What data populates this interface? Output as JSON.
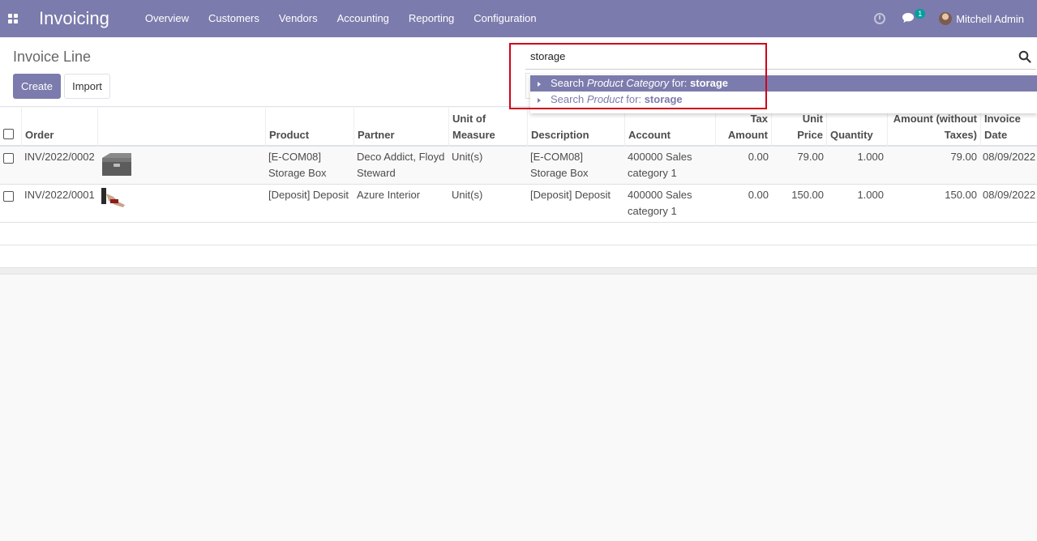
{
  "app": {
    "title": "Invoicing"
  },
  "nav": {
    "menu": [
      "Overview",
      "Customers",
      "Vendors",
      "Accounting",
      "Reporting",
      "Configuration"
    ],
    "chat_badge": "1",
    "user": "Mitchell Admin"
  },
  "control": {
    "title": "Invoice Line",
    "create_label": "Create",
    "import_label": "Import"
  },
  "search": {
    "value": "storage",
    "suggestions": [
      {
        "prefix": "Search",
        "field": "Product Category",
        "mid": "for:",
        "term": "storage"
      },
      {
        "prefix": "Search",
        "field": "Product",
        "mid": "for:",
        "term": "storage"
      }
    ]
  },
  "table": {
    "headers": {
      "order": "Order",
      "image": "",
      "product": "Product",
      "partner": "Partner",
      "uom_1": "Unit of",
      "uom_2": "Measure",
      "description": "Description",
      "account": "Account",
      "tax_1": "Tax",
      "tax_2": "Amount",
      "unit_1": "Unit",
      "unit_2": "Price",
      "quantity": "Quantity",
      "amount_1": "Amount (without",
      "amount_2": "Taxes)",
      "date_1": "Invoice",
      "date_2": "Date"
    },
    "rows": [
      {
        "order": "INV/2022/0002",
        "product_1": "[E-COM08]",
        "product_2": "Storage Box",
        "partner_1": "Deco Addict, Floyd",
        "partner_2": "Steward",
        "uom": "Unit(s)",
        "description_1": "[E-COM08]",
        "description_2": "Storage Box",
        "account_1": "400000 Sales",
        "account_2": "category 1",
        "tax": "0.00",
        "unit_price": "79.00",
        "quantity": "1.000",
        "amount": "79.00",
        "date": "08/09/2022"
      },
      {
        "order": "INV/2022/0001",
        "product_1": "[Deposit] Deposit",
        "partner_1": "Azure Interior",
        "uom": "Unit(s)",
        "description_1": "[Deposit] Deposit",
        "account_1": "400000 Sales",
        "account_2": "category 1",
        "tax": "0.00",
        "unit_price": "150.00",
        "quantity": "1.000",
        "amount": "150.00",
        "date": "08/09/2022"
      }
    ]
  },
  "colors": {
    "brand": "#7c7bad",
    "highlight": "#d0021b",
    "badge": "#00a09d"
  }
}
